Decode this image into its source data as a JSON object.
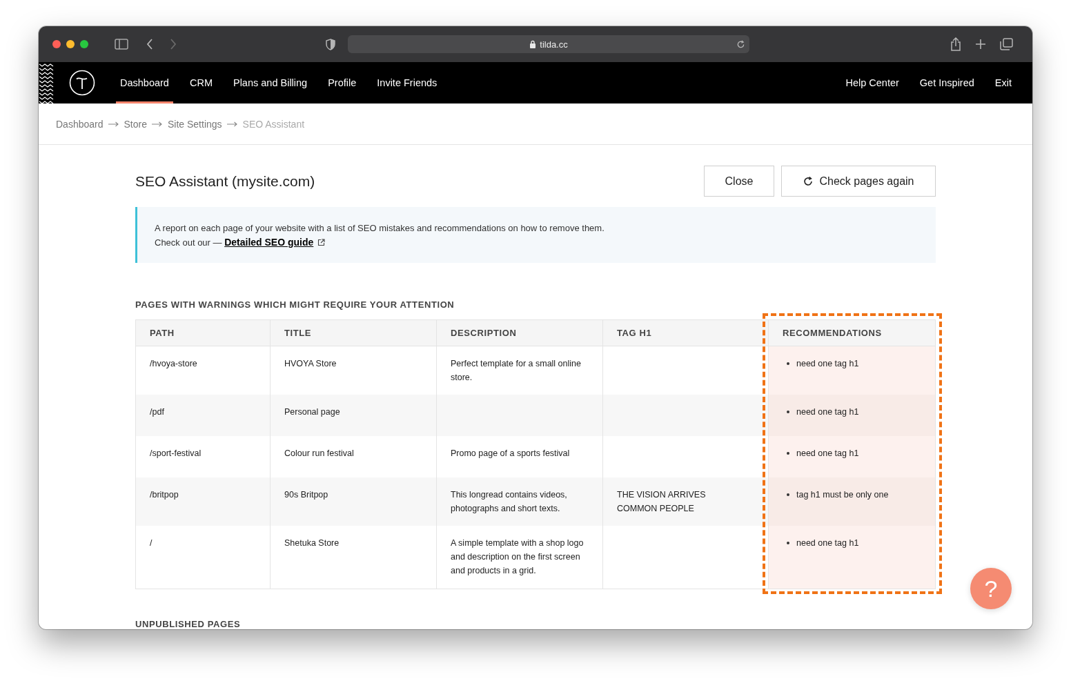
{
  "browser": {
    "url": "tilda.cc"
  },
  "nav": {
    "items": [
      {
        "label": "Dashboard",
        "selected": true
      },
      {
        "label": "CRM",
        "selected": false
      },
      {
        "label": "Plans and Billing",
        "selected": false
      },
      {
        "label": "Profile",
        "selected": false
      },
      {
        "label": "Invite Friends",
        "selected": false
      }
    ],
    "right_items": [
      "Help Center",
      "Get Inspired",
      "Exit"
    ]
  },
  "breadcrumbs": [
    {
      "label": "Dashboard",
      "current": false
    },
    {
      "label": "Store",
      "current": false
    },
    {
      "label": "Site Settings",
      "current": false
    },
    {
      "label": "SEO Assistant",
      "current": true
    }
  ],
  "page": {
    "title": "SEO Assistant (mysite.com)",
    "buttons": [
      {
        "label": "Close",
        "kind": "plain"
      },
      {
        "label": "Check pages again",
        "kind": "refresh"
      }
    ]
  },
  "info": {
    "text": "A report on each page of your website with a list of SEO mistakes and recommendations on how to remove them.",
    "prefix": "Check out our — ",
    "link": "Detailed SEO guide"
  },
  "warnings": {
    "heading": "PAGES WITH WARNINGS WHICH MIGHT REQUIRE YOUR ATTENTION",
    "columns": [
      {
        "label": "PATH",
        "highlighted": false
      },
      {
        "label": "TITLE",
        "highlighted": false
      },
      {
        "label": "DESCRIPTION",
        "highlighted": false
      },
      {
        "label": "TAG H1",
        "highlighted": false
      },
      {
        "label": "RECOMMENDATIONS",
        "highlighted": true
      }
    ],
    "rows": [
      {
        "path": "/hvoya-store",
        "title": "HVOYA Store",
        "description": "Perfect template for a small online store.",
        "tag_h1": [],
        "recommendations": [
          "need one tag h1"
        ]
      },
      {
        "path": "/pdf",
        "title": "Personal page",
        "description": "",
        "tag_h1": [],
        "recommendations": [
          "need one tag h1"
        ]
      },
      {
        "path": "/sport-festival",
        "title": "Colour run festival",
        "description": "Promo page of a sports festival",
        "tag_h1": [],
        "recommendations": [
          "need one tag h1"
        ]
      },
      {
        "path": "/britpop",
        "title": "90s Britpop",
        "description": "This longread contains videos, photographs and short texts.",
        "tag_h1": [
          "THE VISION ARRIVES",
          "COMMON PEOPLE"
        ],
        "recommendations": [
          "tag h1 must be only one"
        ]
      },
      {
        "path": "/",
        "title": "Shetuka Store",
        "description": "A simple template with a shop logo and description on the first screen and products in a grid.",
        "tag_h1": [],
        "recommendations": [
          "need one tag h1"
        ]
      }
    ]
  },
  "unpublished_heading": "UNPUBLISHED PAGES",
  "help_button": {
    "label": "?"
  }
}
